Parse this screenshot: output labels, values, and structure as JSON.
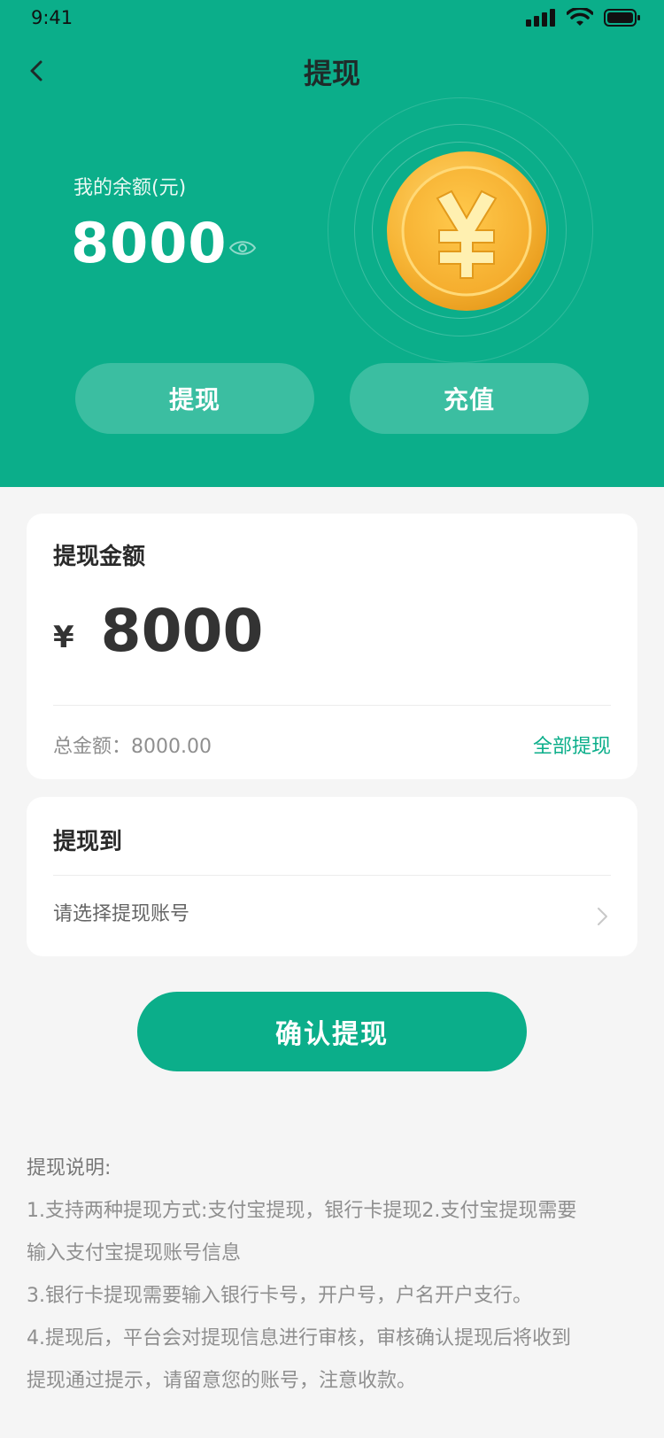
{
  "status": {
    "time": "9:41"
  },
  "nav": {
    "title": "提现"
  },
  "balance": {
    "label": "我的余额(元)",
    "value": "8000"
  },
  "actions": {
    "withdraw": "提现",
    "recharge": "充值"
  },
  "withdraw_card": {
    "title": "提现金额",
    "currency": "¥",
    "amount": "8000",
    "total_label": "总金额：8000.00",
    "withdraw_all": "全部提现"
  },
  "account_card": {
    "title": "提现到",
    "placeholder": "请选择提现账号"
  },
  "confirm_button": "确认提现",
  "notes": {
    "title": "提现说明:",
    "lines": [
      "1.支持两种提现方式:支付宝提现，银行卡提现2.支付宝提现需要",
      "输入支付宝提现账号信息",
      "3.银行卡提现需要输入银行卡号，开户号，户名开户支行。",
      "4.提现后，平台会对提现信息进行审核，审核确认提现后将收到",
      "提现通过提示，请留意您的账号，注意收款。"
    ]
  },
  "colors": {
    "primary": "#0bae8a",
    "coin": "#f6b63b"
  }
}
